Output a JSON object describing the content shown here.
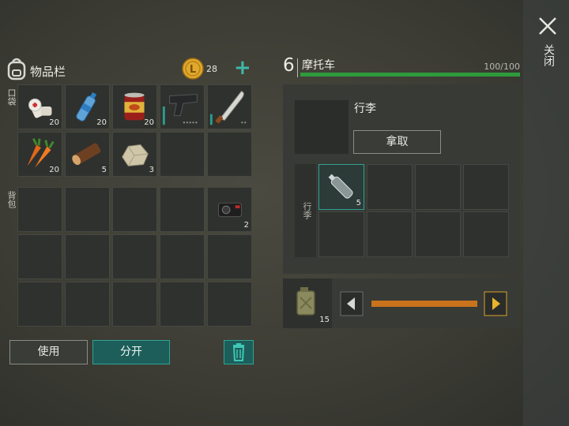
{
  "inventory": {
    "title": "物品栏",
    "coins": "28",
    "add_symbol": "+",
    "pocket_label": "口袋",
    "backpack_label": "背包",
    "pocket_slots": [
      {
        "item": "first-aid-kit",
        "qty": "20"
      },
      {
        "item": "water-bottle",
        "qty": "20"
      },
      {
        "item": "canned-food",
        "qty": "20"
      },
      {
        "item": "pistol",
        "qty": ""
      },
      {
        "item": "machete",
        "qty": ""
      },
      {
        "item": "carrots",
        "qty": "20"
      },
      {
        "item": "log",
        "qty": "5"
      },
      {
        "item": "stone",
        "qty": "3"
      },
      {
        "item": "",
        "qty": ""
      },
      {
        "item": "",
        "qty": ""
      }
    ],
    "backpack_slots": [
      {
        "item": "",
        "qty": ""
      },
      {
        "item": "",
        "qty": ""
      },
      {
        "item": "",
        "qty": ""
      },
      {
        "item": "",
        "qty": ""
      },
      {
        "item": "camera",
        "qty": "2"
      },
      {
        "item": "",
        "qty": ""
      },
      {
        "item": "",
        "qty": ""
      },
      {
        "item": "",
        "qty": ""
      },
      {
        "item": "",
        "qty": ""
      },
      {
        "item": "",
        "qty": ""
      },
      {
        "item": "",
        "qty": ""
      },
      {
        "item": "",
        "qty": ""
      },
      {
        "item": "",
        "qty": ""
      },
      {
        "item": "",
        "qty": ""
      },
      {
        "item": "",
        "qty": ""
      }
    ],
    "use_label": "使用",
    "split_label": "分开"
  },
  "vehicle": {
    "level": "6",
    "name": "摩托车",
    "durability_text": "100/100",
    "durability_fraction": 1.0,
    "luggage_title": "行李",
    "take_label": "拿取",
    "luggage_side_label": "行李",
    "luggage_slots": [
      {
        "item": "empty-plastic-bottle",
        "qty": "5"
      },
      {
        "item": "",
        "qty": ""
      },
      {
        "item": "",
        "qty": ""
      },
      {
        "item": "",
        "qty": ""
      },
      {
        "item": "",
        "qty": ""
      },
      {
        "item": "",
        "qty": ""
      },
      {
        "item": "",
        "qty": ""
      },
      {
        "item": "",
        "qty": ""
      }
    ],
    "fuel_qty": "15",
    "fuel_level_fraction": 1.0
  },
  "close_label": "关闭",
  "colors": {
    "accent_green": "#2f9a3c",
    "teal": "#1d6b67",
    "fuel_orange": "#c9731c",
    "coin_gold": "#d9a22a"
  }
}
